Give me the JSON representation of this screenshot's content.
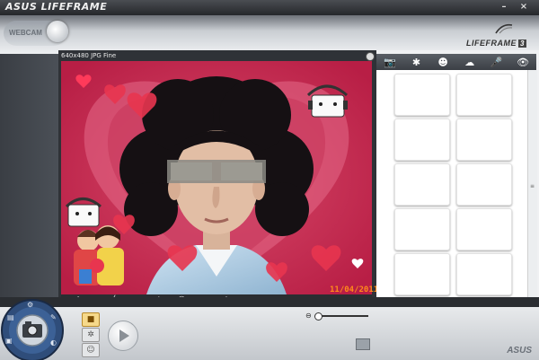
{
  "window": {
    "title": "ASUS LIFEFRAME",
    "minimize": "–",
    "close": "×"
  },
  "header": {
    "mode_label": "WEBCAM",
    "brand": "LIFEFRAME",
    "version": "3"
  },
  "preview": {
    "resolution_label": "640x480 JPG Fine",
    "datestamp": "11/04/2011"
  },
  "tools": [
    "⛰",
    "✚",
    "↻",
    "⧉",
    "╱",
    "▦",
    "▤",
    "◢",
    "✲",
    "◑",
    "☺",
    "⊡",
    "▣",
    "⊞",
    "✎"
  ],
  "tabs": [
    {
      "name": "photo",
      "glyph": "📷"
    },
    {
      "name": "effects",
      "glyph": "✱"
    },
    {
      "name": "face",
      "glyph": "☻"
    },
    {
      "name": "scene",
      "glyph": "☁"
    },
    {
      "name": "audio",
      "glyph": "🎤"
    },
    {
      "name": "view",
      "glyph": "👁"
    }
  ],
  "scroll_thumb": "≡",
  "footer": {
    "brand": "ASUS",
    "zoom_minus": "⊖"
  },
  "modes": [
    {
      "name": "camera",
      "glyph": "■",
      "active": true
    },
    {
      "name": "settings",
      "glyph": "✲",
      "active": false
    },
    {
      "name": "face",
      "glyph": "☺",
      "active": false
    }
  ],
  "colors": {
    "accent": "#ff8a1a",
    "frame": "#2a2d31",
    "panel": "#f0f1f3"
  }
}
